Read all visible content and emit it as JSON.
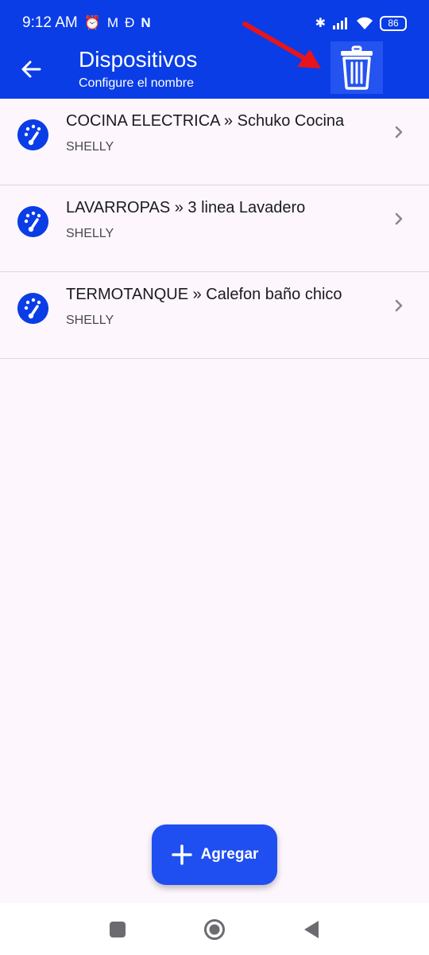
{
  "status_bar": {
    "time": "9:12 AM",
    "left_icons": [
      "alarm-icon",
      "gmail-icon",
      "app-d-icon",
      "netflix-icon"
    ],
    "right_icons": [
      "bluetooth-icon",
      "signal-icon",
      "wifi-icon"
    ],
    "battery": "86"
  },
  "app_bar": {
    "title": "Dispositivos",
    "subtitle": "Configure el nombre",
    "delete_icon": "trash-icon"
  },
  "devices": [
    {
      "title": "COCINA ELECTRICA » Schuko Cocina",
      "subtitle": "SHELLY"
    },
    {
      "title": "LAVARROPAS » 3 linea  Lavadero",
      "subtitle": "SHELLY"
    },
    {
      "title": "TERMOTANQUE » Calefon baño chico",
      "subtitle": "SHELLY"
    }
  ],
  "fab": {
    "label": "Agregar"
  },
  "colors": {
    "primary": "#0a3de6",
    "background": "#fdf6fd",
    "annotation_arrow": "#e8141b"
  }
}
